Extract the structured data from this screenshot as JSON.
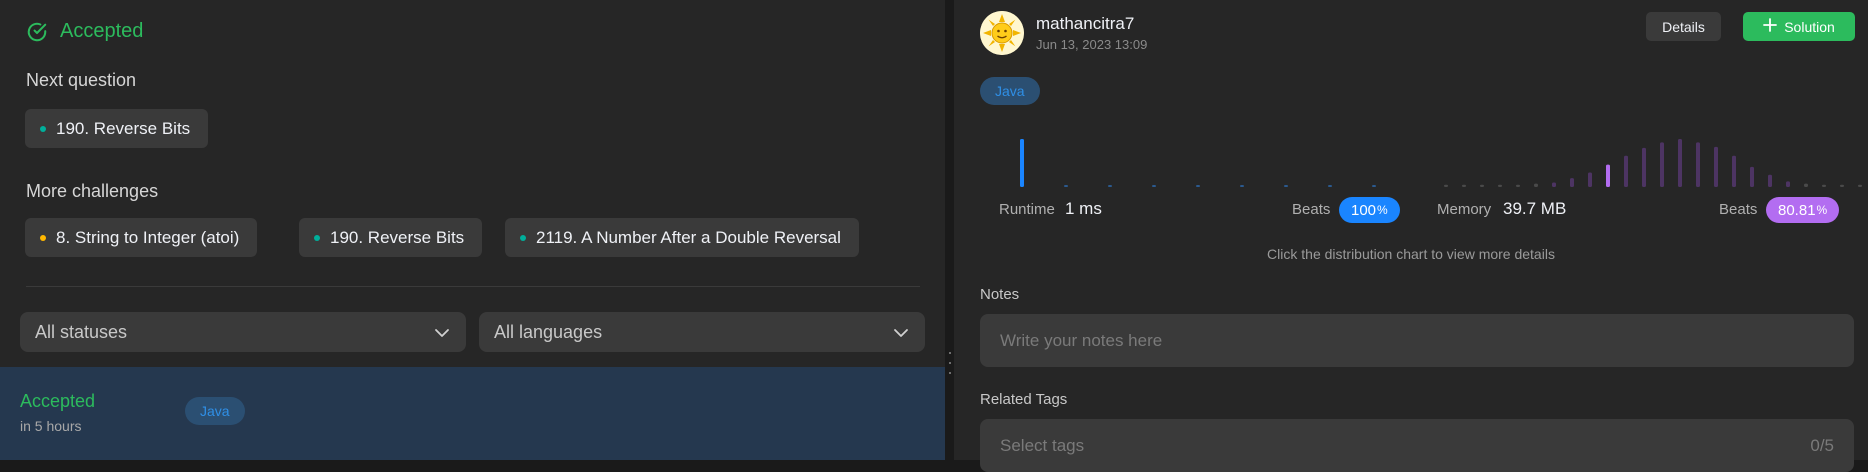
{
  "left": {
    "status_title": "Accepted",
    "next_question_label": "Next question",
    "next_question": {
      "label": "190. Reverse Bits",
      "dot_color": "#00af9b"
    },
    "more_challenges_label": "More challenges",
    "challenges": [
      {
        "label": "8. String to Integer (atoi)",
        "dot_color": "#ffb800"
      },
      {
        "label": "190. Reverse Bits",
        "dot_color": "#00af9b"
      },
      {
        "label": "2119. A Number After a Double Reversal",
        "dot_color": "#00af9b"
      }
    ],
    "filters": {
      "status": "All statuses",
      "language": "All languages"
    },
    "submission": {
      "status": "Accepted",
      "time": "in 5 hours",
      "language": "Java"
    }
  },
  "right": {
    "user": {
      "name": "mathancitra7",
      "date": "Jun 13, 2023 13:09"
    },
    "buttons": {
      "details": "Details",
      "solution": "Solution"
    },
    "language_badge": "Java",
    "runtime": {
      "label": "Runtime",
      "value": "1 ms",
      "beats_label": "Beats",
      "beats_value": "100",
      "beats_unit": "%"
    },
    "memory": {
      "label": "Memory",
      "value": "39.7 MB",
      "beats_label": "Beats",
      "beats_value": "80.81",
      "beats_unit": "%"
    },
    "hint": "Click the distribution chart to view more details",
    "notes": {
      "label": "Notes",
      "placeholder": "Write your notes here"
    },
    "tags": {
      "label": "Related Tags",
      "placeholder": "Select tags",
      "count": "0/5"
    }
  },
  "colors": {
    "accepted": "#2cbb5d",
    "runtime_bar": "#1a85ff",
    "memory_bar": "#b36df1",
    "memory_bar_dim": "#4d3463"
  },
  "chart_data": [
    {
      "type": "bar",
      "series": [
        {
          "values": [
            100,
            4,
            4,
            4,
            4,
            4,
            4,
            4,
            4
          ]
        }
      ],
      "highlight_index": 0
    },
    {
      "type": "bar",
      "series": [
        {
          "values": [
            4,
            4,
            4,
            4,
            4,
            6,
            8,
            16,
            26,
            40,
            56,
            70,
            80,
            86,
            80,
            72,
            56,
            36,
            22,
            10,
            6,
            4,
            4,
            4
          ]
        }
      ],
      "highlight_index": 9
    }
  ]
}
